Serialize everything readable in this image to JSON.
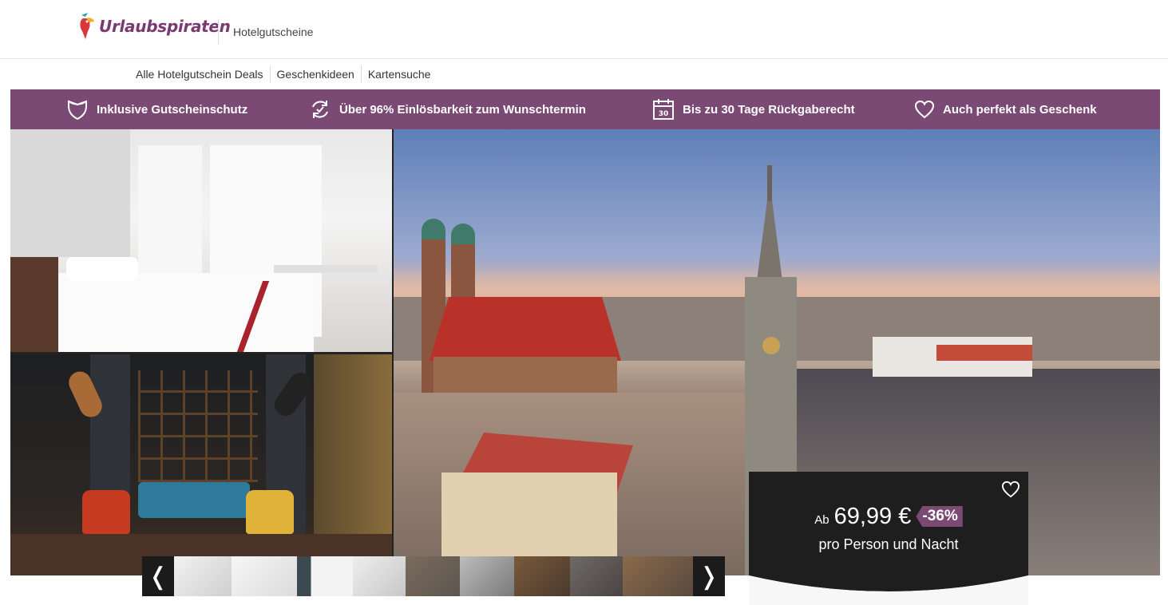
{
  "header": {
    "logo_text": "Urlaubspiraten",
    "section_title": "Hotelgutscheine"
  },
  "subnav": {
    "items": [
      "Alle Hotelgutschein Deals",
      "Geschenkideen",
      "Kartensuche"
    ]
  },
  "benefits": [
    {
      "icon": "shield-icon",
      "label": "Inklusive Gutscheinschutz"
    },
    {
      "icon": "refresh-check-icon",
      "label": "Über 96% Einlösbarkeit zum Wunschtermin"
    },
    {
      "icon": "calendar-icon",
      "label": "Bis zu 30 Tage Rückgaberecht",
      "icon_text": "30"
    },
    {
      "icon": "heart-icon",
      "label": "Auch perfekt als Geschenk"
    }
  ],
  "gallery": {
    "prev_label": "❬",
    "next_label": "❭"
  },
  "price": {
    "prefix": "Ab",
    "amount": "69,99 €",
    "discount": "-36%",
    "unit": "pro Person und Nacht"
  },
  "colors": {
    "brand_purple": "#7b4a74",
    "card_dark": "#1e1e1e"
  }
}
